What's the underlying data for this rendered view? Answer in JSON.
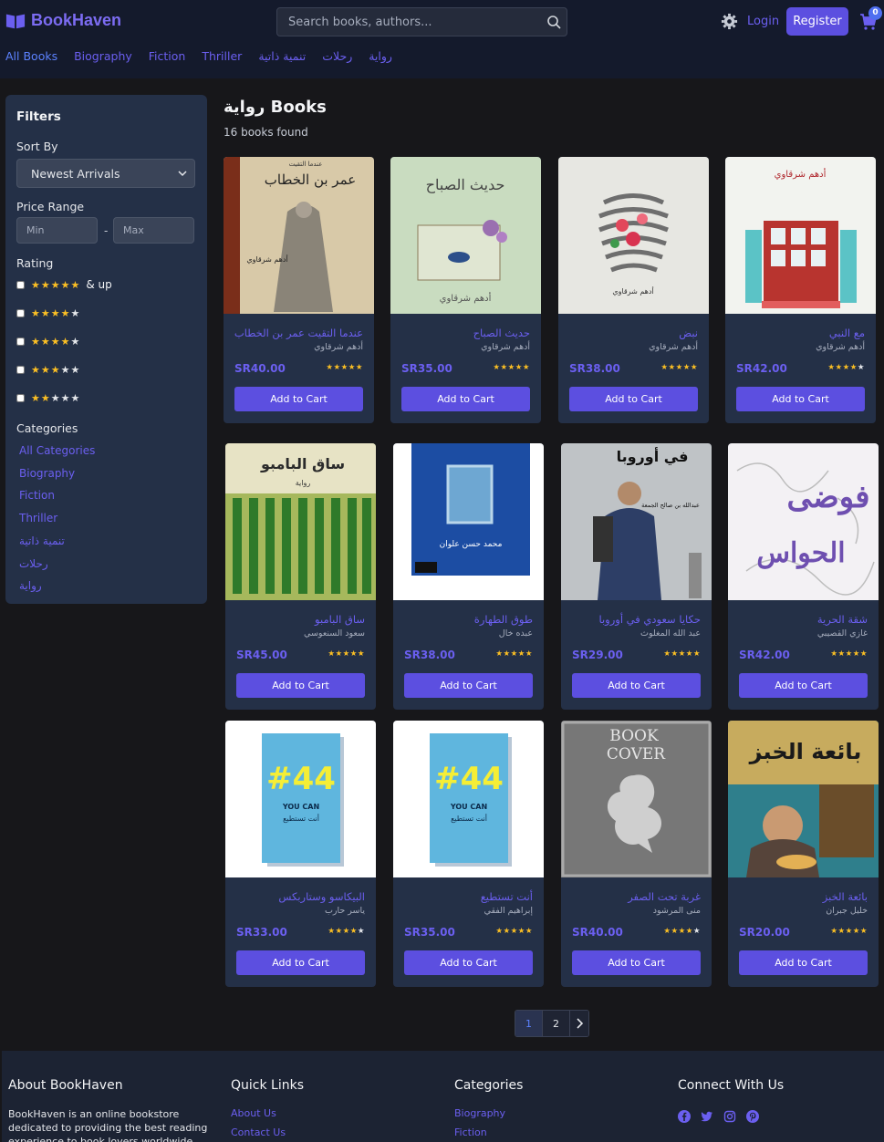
{
  "header": {
    "logo_text": "BookHaven",
    "search_placeholder": "Search books, authors...",
    "login_label": "Login",
    "register_label": "Register",
    "cart_count": "0",
    "nav": [
      "All Books",
      "Biography",
      "Fiction",
      "Thriller",
      "تنمية ذاتية",
      "رحلات",
      "رواية"
    ]
  },
  "sidebar": {
    "title": "Filters",
    "sort_label": "Sort By",
    "sort_value": "Newest Arrivals",
    "price_label": "Price Range",
    "price_min_placeholder": "Min",
    "price_max_placeholder": "Max",
    "price_separator": "-",
    "rating_label": "Rating",
    "rating_and_up": "& up",
    "ratings": [
      5,
      4,
      4,
      3,
      2
    ],
    "categories_label": "Categories",
    "categories": [
      "All Categories",
      "Biography",
      "Fiction",
      "Thriller",
      "تنمية ذاتية",
      "رحلات",
      "رواية"
    ]
  },
  "main": {
    "title": "رواية Books",
    "count": "16 books found",
    "add_to_cart_label": "Add to Cart",
    "books": [
      {
        "title": "عندما التقيت عمر بن الخطاب",
        "author": "أدهم شرقاوي",
        "price": "SR40.00",
        "rating": 5,
        "cover": "umar"
      },
      {
        "title": "حديث الصباح",
        "author": "أدهم شرقاوي",
        "price": "SR35.00",
        "rating": 5,
        "cover": "sabah"
      },
      {
        "title": "نبض",
        "author": "أدهم شرقاوي",
        "price": "SR38.00",
        "rating": 5,
        "cover": "nabd"
      },
      {
        "title": "مع النبي",
        "author": "أدهم شرقاوي",
        "price": "SR42.00",
        "rating": 4,
        "cover": "nabi"
      },
      {
        "title": "ساق البامبو",
        "author": "سعود السنعوسي",
        "price": "SR45.00",
        "rating": 5,
        "cover": "bamboo"
      },
      {
        "title": "طوق الطهارة",
        "author": "عبده خال",
        "price": "SR38.00",
        "rating": 5,
        "cover": "tawq"
      },
      {
        "title": "حكايا سعودي في أوروبا",
        "author": "عبد الله المغلوث",
        "price": "SR29.00",
        "rating": 5,
        "cover": "europe"
      },
      {
        "title": "شقة الحرية",
        "author": "غازي القصيبي",
        "price": "SR42.00",
        "rating": 5,
        "cover": "fawda"
      },
      {
        "title": "البيكاسو وستاربكس",
        "author": "ياسر حارب",
        "price": "SR33.00",
        "rating": 4,
        "cover": "book44"
      },
      {
        "title": "أنت تستطيع",
        "author": "إبراهيم الفقي",
        "price": "SR35.00",
        "rating": 5,
        "cover": "book44"
      },
      {
        "title": "غربة تحت الصفر",
        "author": "منى المرشود",
        "price": "SR40.00",
        "rating": 4,
        "cover": "placeholder"
      },
      {
        "title": "بائعة الخبز",
        "author": "خليل جبران",
        "price": "SR20.00",
        "rating": 5,
        "cover": "khubz"
      }
    ],
    "cover_text": {
      "umar_top": "عندما التقيت",
      "umar_big": "عمر بن الخطاب",
      "umar_author": "أدهم شرقاوي",
      "sabah_title": "حديث الصباح",
      "sabah_author": "أدهم شرقاوي",
      "nabd_author": "أدهم شرقاوي",
      "nabi_author": "أدهم شرقاوي",
      "bamboo_title": "ساق البامبو",
      "bamboo_sub": "رواية",
      "tawq_author": "محمد حسن علوان",
      "europe_top": "في أوروبا",
      "europe_author": "عبدالله بن صالح الجمعة",
      "fawda_title": "فوضى الحواس",
      "b44_num": "#44",
      "b44_en": "YOU CAN",
      "b44_ar": "أنت تستطيع",
      "ph_line1": "BOOK",
      "ph_line2": "COVER",
      "khubz_title": "بائعة الخبز"
    }
  },
  "pagination": {
    "pages": [
      "1",
      "2"
    ],
    "current": "1"
  },
  "footer": {
    "about_title": "About BookHaven",
    "about_text": "BookHaven is an online bookstore dedicated to providing the best reading experience to book lovers worldwide.",
    "quick_title": "Quick Links",
    "quick_links": [
      "About Us",
      "Contact Us"
    ],
    "categories_title": "Categories",
    "categories_links": [
      "Biography",
      "Fiction"
    ],
    "connect_title": "Connect With Us",
    "social": [
      "facebook-icon",
      "twitter-icon",
      "instagram-icon",
      "pinterest-icon"
    ]
  },
  "colors": {
    "accent": "#5c4fe0",
    "link": "#6b5ff0",
    "star": "#fbbf24",
    "card": "#243047",
    "header": "#141a2c"
  }
}
